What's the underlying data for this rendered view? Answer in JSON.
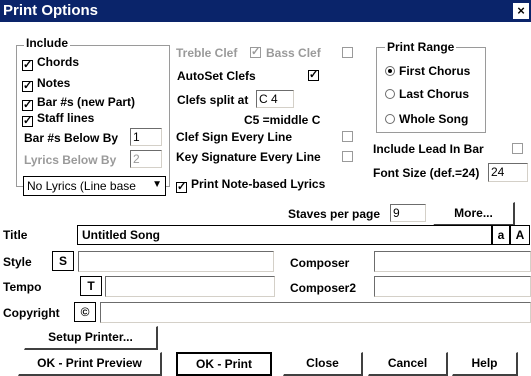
{
  "window": {
    "title": "Print Options",
    "close_glyph": "×"
  },
  "include": {
    "label": "Include",
    "chords": {
      "label": "Chords",
      "checked": true
    },
    "notes": {
      "label": "Notes",
      "checked": true
    },
    "bar_nums": {
      "label": "Bar #s (new Part)",
      "checked": true
    },
    "staff_lines": {
      "label": "Staff lines",
      "checked": true
    },
    "bar_nums_below_by": {
      "label": "Bar #s Below By",
      "value": "1"
    },
    "lyrics_below_by": {
      "label": "Lyrics Below By",
      "value": "2"
    },
    "lyrics_mode": {
      "selected": "No Lyrics (Line base"
    }
  },
  "clefs": {
    "treble_clef": {
      "label": "Treble Clef",
      "checked": true
    },
    "bass_clef": {
      "label": "Bass Clef",
      "checked": false
    },
    "autoset_clefs": {
      "label": "AutoSet Clefs",
      "checked": true
    },
    "clefs_split_at": {
      "label": "Clefs split at",
      "value": "C 4"
    },
    "c5_note": "C5 =middle C",
    "clef_sign_every_line": {
      "label": "Clef Sign Every Line",
      "checked": false
    },
    "key_sig_every_line": {
      "label": "Key Signature Every Line",
      "checked": false
    },
    "print_note_lyrics": {
      "label": "Print Note-based Lyrics",
      "checked": true
    }
  },
  "print_range": {
    "label": "Print Range",
    "options": [
      "First Chorus",
      "Last Chorus",
      "Whole Song"
    ],
    "selected": "First Chorus"
  },
  "include_lead_in_bar": {
    "label": "Include Lead In Bar",
    "checked": false
  },
  "font_size": {
    "label": "Font Size (def.=24)",
    "value": "24"
  },
  "staves_per_page": {
    "label": "Staves per page",
    "value": "9"
  },
  "more_button": "More...",
  "title": {
    "label": "Title",
    "value": "Untitled Song",
    "btn_a_small": "a",
    "btn_a_large": "A"
  },
  "style": {
    "label": "Style",
    "btn": "S",
    "value": ""
  },
  "tempo": {
    "label": "Tempo",
    "btn": "T",
    "value": ""
  },
  "composer": {
    "label": "Composer",
    "value": ""
  },
  "composer2": {
    "label": "Composer2",
    "value": ""
  },
  "copyright": {
    "label": "Copyright",
    "btn": "©",
    "value": ""
  },
  "setup_printer": "Setup Printer...",
  "buttons": {
    "ok_preview": "OK - Print Preview",
    "ok_print": "OK - Print",
    "close": "Close",
    "cancel": "Cancel",
    "help": "Help"
  }
}
